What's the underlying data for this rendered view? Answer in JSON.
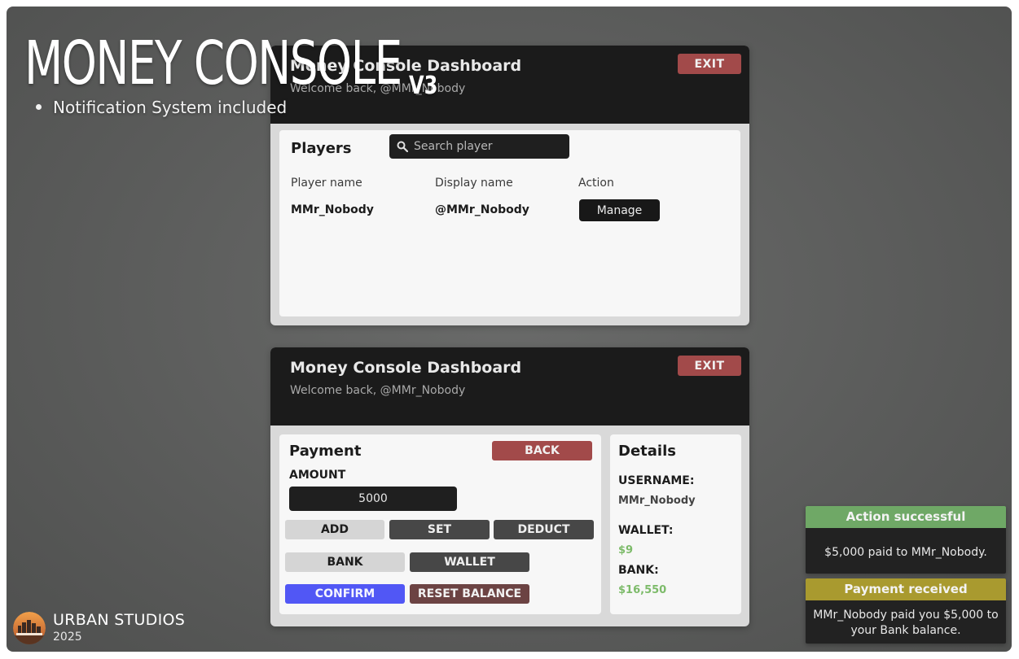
{
  "hero": {
    "title": "MONEY CONSOLE",
    "version": "V3",
    "features": [
      "Notification System included"
    ]
  },
  "dashboard": {
    "title": "Money Console Dashboard",
    "welcome": "Welcome back, @MMr_Nobody",
    "exit_label": "EXIT"
  },
  "players_panel": {
    "title": "Players",
    "search_placeholder": "Search player",
    "columns": [
      "Player name",
      "Display name",
      "Action"
    ],
    "rows": [
      {
        "player_name": "MMr_Nobody",
        "display_name": "@MMr_Nobody",
        "action_label": "Manage"
      }
    ]
  },
  "payment_panel": {
    "title": "Payment",
    "back_label": "BACK",
    "amount_label": "AMOUNT",
    "amount_value": "5000",
    "modes": [
      "ADD",
      "SET",
      "DEDUCT"
    ],
    "targets": [
      "BANK",
      "WALLET"
    ],
    "confirm_label": "CONFIRM",
    "reset_label": "RESET BALANCE"
  },
  "details_panel": {
    "title": "Details",
    "username_label": "USERNAME:",
    "username_value": "MMr_Nobody",
    "wallet_label": "WALLET:",
    "wallet_value": "$9",
    "bank_label": "BANK:",
    "bank_value": "$16,550"
  },
  "notifications": [
    {
      "title": "Action successful",
      "message": "$5,000 paid to MMr_Nobody.",
      "color": "#6fa866"
    },
    {
      "title": "Payment received",
      "message": "MMr_Nobody paid you $5,000 to your Bank balance.",
      "color": "#a99a2f"
    }
  ],
  "colors": {
    "exit": "#a24a4a",
    "confirm": "#5157f5",
    "money_green": "#7dbb6a",
    "header_dark": "#1b1b1b"
  },
  "footer": {
    "brand": "URBAN STUDIOS",
    "year": "2025",
    "logo_icon": "urban-studios-logo-icon"
  }
}
